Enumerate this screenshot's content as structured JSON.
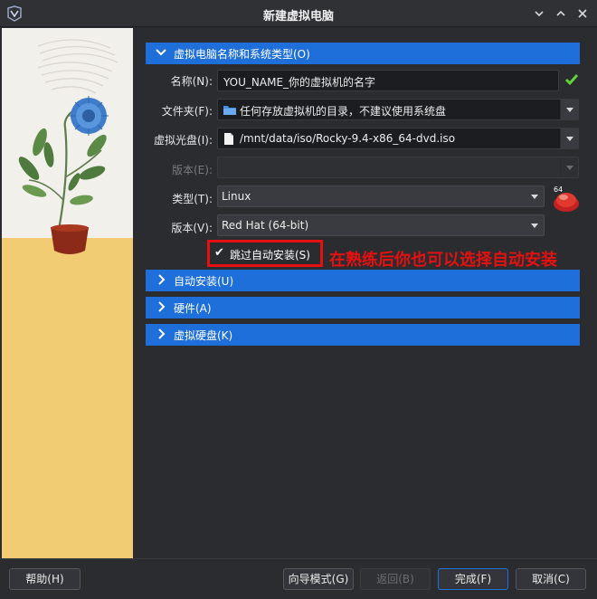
{
  "window": {
    "title": "新建虚拟电脑"
  },
  "sections": {
    "name_os": {
      "label": "虚拟电脑名称和系统类型(O)",
      "expanded": true
    },
    "unattended": {
      "label": "自动安装(U)",
      "expanded": false
    },
    "hardware": {
      "label": "硬件(A)",
      "expanded": false
    },
    "disk": {
      "label": "虚拟硬盘(K)",
      "expanded": false
    }
  },
  "form": {
    "name": {
      "label": "名称(N):",
      "value": "YOU_NAME_你的虚拟机的名字"
    },
    "folder": {
      "label": "文件夹(F):",
      "value": "任何存放虚拟机的目录，不建议使用系统盘"
    },
    "iso": {
      "label": "虚拟光盘(I):",
      "value": "/mnt/data/iso/Rocky-9.4-x86_64-dvd.iso"
    },
    "edition": {
      "label": "版本(E):",
      "value": ""
    },
    "type": {
      "label": "类型(T):",
      "value": "Linux"
    },
    "version": {
      "label": "版本(V):",
      "value": "Red Hat (64-bit)"
    },
    "skip_unattended": {
      "label": "跳过自动安装(S)",
      "checked": true
    }
  },
  "os_badge": "64",
  "annotation": "在熟练后你也可以选择自动安装",
  "buttons": {
    "help": "帮助(H)",
    "guided": "向导模式(G)",
    "back": "返回(B)",
    "finish": "完成(F)",
    "cancel": "取消(C)"
  },
  "colors": {
    "accent": "#1e6fd9",
    "annotation": "#e51010",
    "valid": "#5fd43a"
  }
}
